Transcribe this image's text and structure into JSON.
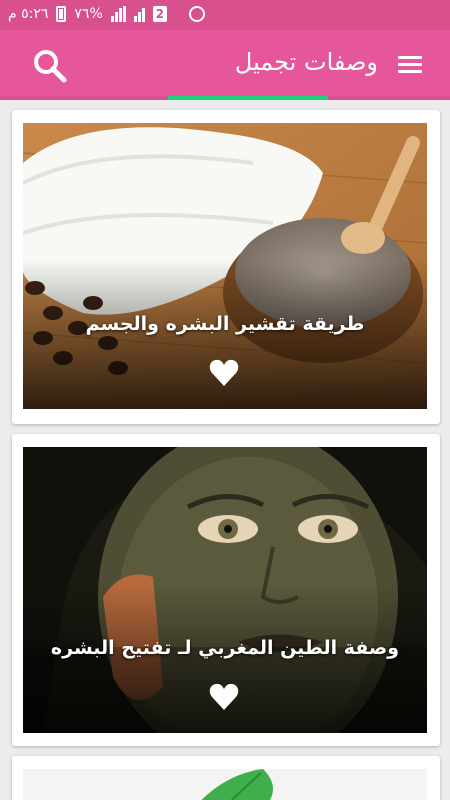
{
  "status_bar": {
    "time": "٥:٢٦ م",
    "battery": "٧٦%",
    "sim_badge": "2"
  },
  "app_bar": {
    "title": "وصفات تجميل",
    "menu_icon": "menu-icon",
    "search_icon": "search-icon",
    "accent_color": "#e5579a",
    "progress_color": "#1ed07a"
  },
  "recipes": [
    {
      "title": "طريقة تقشير البشره والجسم",
      "icon": "heart-icon"
    },
    {
      "title": "وصفة الطين المغربي لـ تفتيح البشره",
      "icon": "heart-icon"
    }
  ]
}
